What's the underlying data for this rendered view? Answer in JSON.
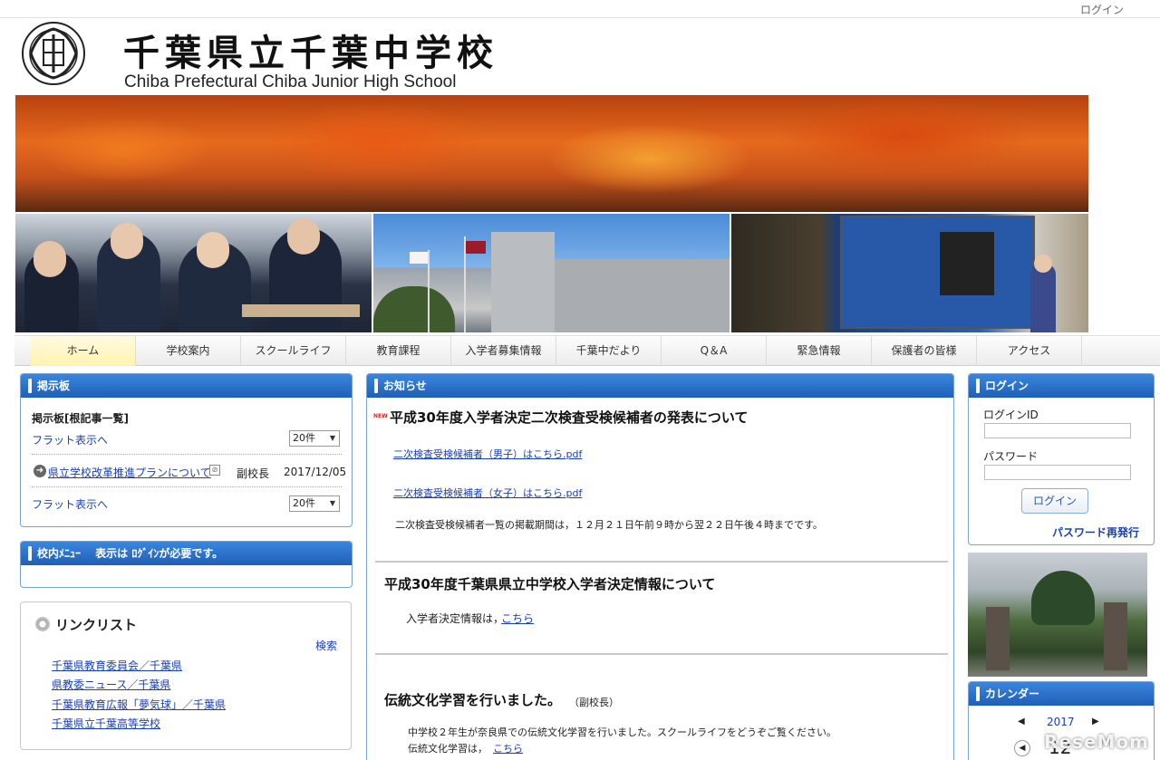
{
  "topbar": {
    "login": "ログイン"
  },
  "header": {
    "school_name_ja": "千葉県立千葉中学校",
    "school_name_en": "Chiba Prefectural Chiba Junior High School"
  },
  "nav": {
    "items": [
      {
        "label": "ホーム"
      },
      {
        "label": "学校案内"
      },
      {
        "label": "スクールライフ"
      },
      {
        "label": "教育課程"
      },
      {
        "label": "入学者募集情報"
      },
      {
        "label": "千葉中だより"
      },
      {
        "label": "Q＆A"
      },
      {
        "label": "緊急情報"
      },
      {
        "label": "保護者の皆様"
      },
      {
        "label": "アクセス"
      }
    ]
  },
  "bbs": {
    "title": "掲示板",
    "subtitle": "掲示板[根記事一覧]",
    "flat_view": "フラット表示へ",
    "count": "20件",
    "item_title": "県立学校改革推進プランについて",
    "item_author": "副校長",
    "item_date": "2017/12/05",
    "flat_view_2": "フラット表示へ",
    "count_2": "20件"
  },
  "school_menu": {
    "title": "校内ﾒﾆｭｰ　 表示は ﾛｸﾞｲﾝが必要です。"
  },
  "link_list": {
    "title": "リンクリスト",
    "search": "検索",
    "links": [
      "千葉県教育委員会／千葉県",
      "県教委ニュース／千葉県",
      "千葉県教育広報「夢気球」／千葉県",
      "千葉県立千葉高等学校"
    ]
  },
  "news": {
    "title": "お知らせ",
    "new_badge": "NEW",
    "items": [
      {
        "title": "平成30年度入学者決定二次検査受検候補者の発表について",
        "link1": "二次検査受検候補者（男子）はこちら.pdf",
        "link2": "二次検査受検候補者（女子）はこちら.pdf",
        "body": "二次検査受検候補者一覧の掲載期間は，１２月２１日午前９時から翌２２日午後４時までです。"
      },
      {
        "title": "平成30年度千葉県県立中学校入学者決定情報について",
        "body_prefix": "入学者決定情報は，",
        "body_link": "こちら"
      },
      {
        "title": "伝統文化学習を行いました。",
        "title_note": "（副校長）",
        "body": "中学校２年生が奈良県での伝統文化学習を行いました。スクールライフをどうぞご覧ください。",
        "body2_prefix": "伝統文化学習は，",
        "body2_link": "こちら"
      }
    ]
  },
  "login": {
    "title": "ログイン",
    "id_label": "ログインID",
    "password_label": "パスワード",
    "button": "ログイン",
    "reissue": "パスワード再発行"
  },
  "calendar": {
    "title": "カレンダー",
    "year": "2017",
    "month": "12",
    "prev": "◀",
    "next": "▶"
  },
  "watermark": "ReseMom"
}
